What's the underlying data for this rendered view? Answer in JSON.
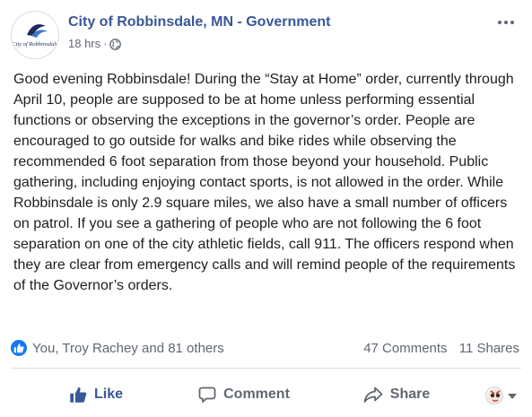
{
  "post": {
    "page_name": "City of Robbinsdale, MN - Government",
    "avatar_text": "City of Robbinsdale",
    "timestamp": "18 hrs",
    "separator": "·",
    "privacy_icon": "globe-icon",
    "body": "Good evening Robbinsdale! During the “Stay at Home” order, currently through April 10, people are supposed to be at home unless performing essential functions or observing the exceptions in the governor’s order. People are encouraged to go outside for walks and bike rides while observing the recommended 6 foot separation from those beyond your household. Public gathering, including enjoying contact sports, is not allowed in the order. While Robbinsdale is only 2.9 square miles, we also have a small number of officers on patrol. If you see a gathering of people who are not following the 6 foot separation on one of the city athletic fields, call 911. The officers respond when they are clear from emergency calls and will remind people of the requirements of the Governor’s orders."
  },
  "reactions": {
    "names": "You, Troy Rachey and 81 others",
    "comments": "47 Comments",
    "shares": "11 Shares"
  },
  "actions": {
    "like": "Like",
    "comment": "Comment",
    "share": "Share"
  },
  "colors": {
    "brand_blue": "#385898",
    "like_blue": "#1877f2",
    "muted_text": "#606770"
  }
}
